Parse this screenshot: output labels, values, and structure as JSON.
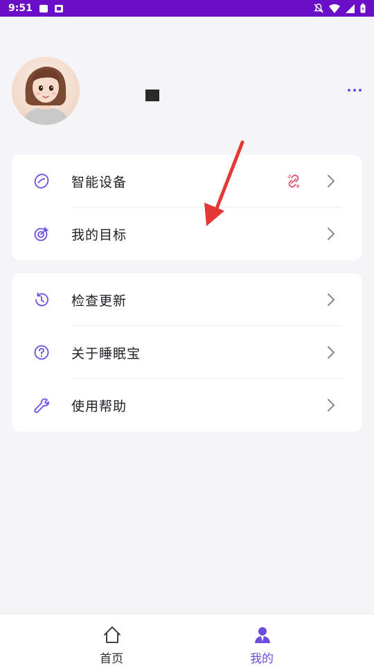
{
  "status_bar": {
    "time": "9:51"
  },
  "profile": {
    "avatar_icon": "avatar-girl"
  },
  "menu_group_1": [
    {
      "label": "智能设备",
      "icon": "ring-device-icon"
    },
    {
      "label": "我的目标",
      "icon": "target-icon"
    }
  ],
  "menu_group_2": [
    {
      "label": "检查更新",
      "icon": "history-icon"
    },
    {
      "label": "关于睡眠宝",
      "icon": "help-circle-icon"
    },
    {
      "label": "使用帮助",
      "icon": "wrench-icon"
    }
  ],
  "bottom_nav": {
    "home_label": "首页",
    "mine_label": "我的"
  },
  "colors": {
    "accent": "#6a4ce0",
    "status_bar": "#6a0fc7",
    "link_broken": "#e5506b",
    "arrow": "#e53935"
  }
}
